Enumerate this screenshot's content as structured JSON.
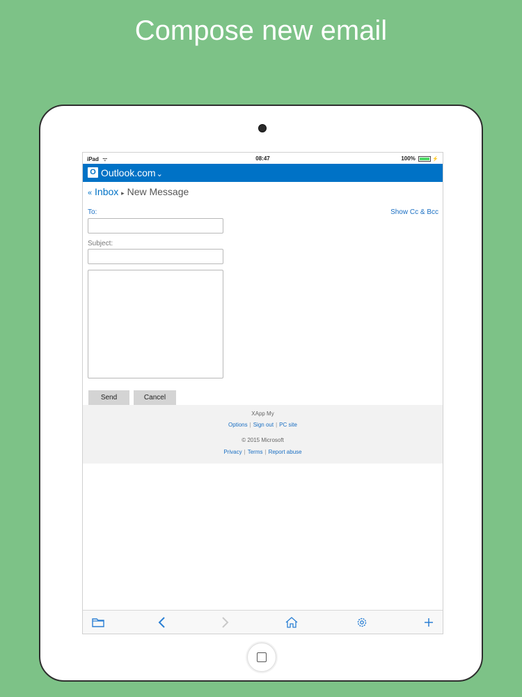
{
  "headline": "Compose new email",
  "status_bar": {
    "device": "iPad",
    "time": "08:47",
    "battery": "100%"
  },
  "app_header": {
    "logo_letter": "O",
    "title": "Outlook.com",
    "dropdown_glyph": "⌄",
    "accent": "#0072c6"
  },
  "breadcrumb": {
    "back_glyph": "«",
    "inbox": "Inbox",
    "separator": "▸",
    "current": "New Message"
  },
  "compose": {
    "to_label": "To:",
    "to_value": "",
    "show_cc_bcc": "Show Cc & Bcc",
    "subject_label": "Subject:",
    "subject_value": "",
    "body_value": "",
    "send": "Send",
    "cancel": "Cancel"
  },
  "footer": {
    "account": "XApp My",
    "links_top": [
      "Options",
      "Sign out",
      "PC site"
    ],
    "copyright": "© 2015 Microsoft",
    "links_bottom": [
      "Privacy",
      "Terms",
      "Report abuse"
    ]
  },
  "toolbar": {
    "icons": [
      "folder-icon",
      "back-icon",
      "forward-icon",
      "home-icon",
      "settings-icon",
      "plus-icon"
    ]
  },
  "colors": {
    "background": "#7dc287",
    "link": "#1a6fc3"
  }
}
